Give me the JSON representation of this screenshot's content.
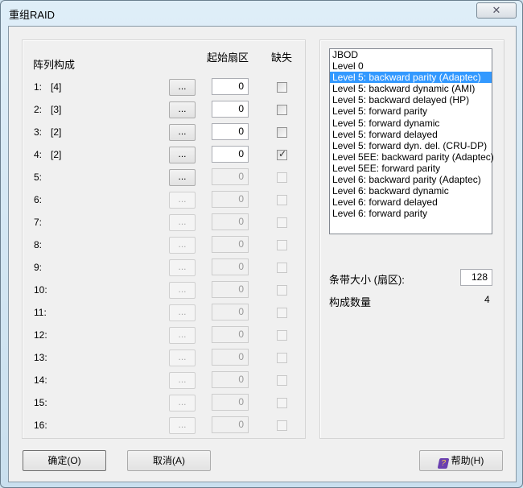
{
  "window": {
    "title": "重组RAID",
    "close_icon": "close-icon"
  },
  "left": {
    "header": "阵列构成",
    "col_start": "起始扇区",
    "col_missing": "缺失",
    "rows": [
      {
        "label": "1:",
        "disk": "[4]",
        "browse": "...",
        "start": "0",
        "missing": false,
        "enabled": true,
        "browse_enabled": true
      },
      {
        "label": "2:",
        "disk": "[3]",
        "browse": "...",
        "start": "0",
        "missing": false,
        "enabled": true,
        "browse_enabled": true
      },
      {
        "label": "3:",
        "disk": "[2]",
        "browse": "...",
        "start": "0",
        "missing": false,
        "enabled": true,
        "browse_enabled": true
      },
      {
        "label": "4:",
        "disk": "[2]",
        "browse": "...",
        "start": "0",
        "missing": true,
        "enabled": true,
        "browse_enabled": true
      },
      {
        "label": "5:",
        "disk": "",
        "browse": "...",
        "start": "0",
        "missing": false,
        "enabled": false,
        "browse_enabled": true
      },
      {
        "label": "6:",
        "disk": "",
        "browse": "...",
        "start": "0",
        "missing": false,
        "enabled": false,
        "browse_enabled": false
      },
      {
        "label": "7:",
        "disk": "",
        "browse": "...",
        "start": "0",
        "missing": false,
        "enabled": false,
        "browse_enabled": false
      },
      {
        "label": "8:",
        "disk": "",
        "browse": "...",
        "start": "0",
        "missing": false,
        "enabled": false,
        "browse_enabled": false
      },
      {
        "label": "9:",
        "disk": "",
        "browse": "...",
        "start": "0",
        "missing": false,
        "enabled": false,
        "browse_enabled": false
      },
      {
        "label": "10:",
        "disk": "",
        "browse": "...",
        "start": "0",
        "missing": false,
        "enabled": false,
        "browse_enabled": false
      },
      {
        "label": "11:",
        "disk": "",
        "browse": "...",
        "start": "0",
        "missing": false,
        "enabled": false,
        "browse_enabled": false
      },
      {
        "label": "12:",
        "disk": "",
        "browse": "...",
        "start": "0",
        "missing": false,
        "enabled": false,
        "browse_enabled": false
      },
      {
        "label": "13:",
        "disk": "",
        "browse": "...",
        "start": "0",
        "missing": false,
        "enabled": false,
        "browse_enabled": false
      },
      {
        "label": "14:",
        "disk": "",
        "browse": "...",
        "start": "0",
        "missing": false,
        "enabled": false,
        "browse_enabled": false
      },
      {
        "label": "15:",
        "disk": "",
        "browse": "...",
        "start": "0",
        "missing": false,
        "enabled": false,
        "browse_enabled": false
      },
      {
        "label": "16:",
        "disk": "",
        "browse": "...",
        "start": "0",
        "missing": false,
        "enabled": false,
        "browse_enabled": false
      }
    ]
  },
  "right": {
    "raid_levels": [
      "JBOD",
      "Level 0",
      "Level 5: backward parity (Adaptec)",
      "Level 5: backward dynamic (AMI)",
      "Level 5: backward delayed (HP)",
      "Level 5: forward parity",
      "Level 5: forward dynamic",
      "Level 5: forward delayed",
      "Level 5: forward dyn. del. (CRU-DP)",
      "Level 5EE: backward parity (Adaptec)",
      "Level 5EE: forward parity",
      "Level 6: backward parity (Adaptec)",
      "Level 6: backward dynamic",
      "Level 6: forward delayed",
      "Level 6: forward parity"
    ],
    "selected_index": 2,
    "stripe_label": "条带大小 (扇区):",
    "stripe_value": "128",
    "count_label": "构成数量",
    "count_value": "4"
  },
  "buttons": {
    "ok": "确定(O)",
    "cancel": "取消(A)",
    "help": "帮助(H)",
    "help_icon": "help-book-icon"
  },
  "colors": {
    "selection": "#3399ff"
  }
}
